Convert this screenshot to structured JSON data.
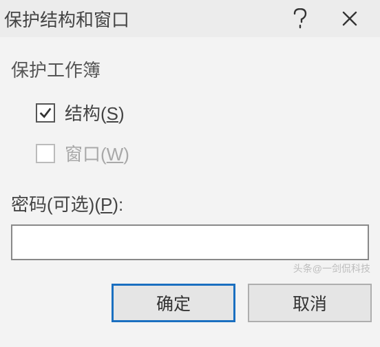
{
  "titlebar": {
    "title": "保护结构和窗口"
  },
  "group": {
    "label": "保护工作簿",
    "structure": {
      "label": "结构(",
      "mnemonic": "S",
      "suffix": ")",
      "checked": true
    },
    "window": {
      "label": "窗口(",
      "mnemonic": "W",
      "suffix": ")",
      "checked": false,
      "disabled": true
    }
  },
  "password": {
    "label_pre": "密码(可选)(",
    "mnemonic": "P",
    "label_post": "):",
    "value": ""
  },
  "buttons": {
    "ok": "确定",
    "cancel": "取消"
  },
  "watermark": "头条@一剑侃科技"
}
